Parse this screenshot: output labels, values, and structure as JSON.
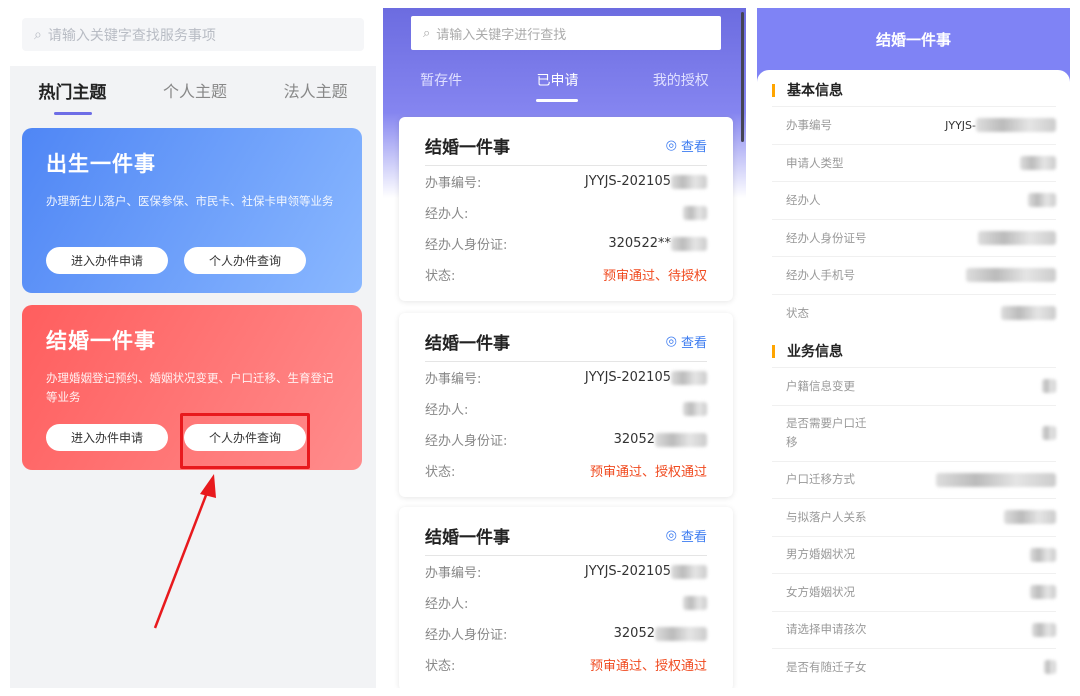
{
  "left": {
    "search_placeholder": "请输入关键字查找服务事项",
    "tabs": [
      "热门主题",
      "个人主题",
      "法人主题"
    ],
    "cards": [
      {
        "title": "出生一件事",
        "desc": "办理新生儿落户、医保参保、市民卡、社保卡申领等业务",
        "btn_apply": "进入办件申请",
        "btn_query": "个人办件查询"
      },
      {
        "title": "结婚一件事",
        "desc": "办理婚姻登记预约、婚姻状况变更、户口迁移、生育登记等业务",
        "btn_apply": "进入办件申请",
        "btn_query": "个人办件查询"
      }
    ]
  },
  "mid": {
    "search_placeholder": "请输入关键字进行查找",
    "tabs": [
      "暂存件",
      "已申请",
      "我的授权"
    ],
    "view_label": "查看",
    "labels": {
      "id": "办事编号:",
      "agent": "经办人:",
      "idcard": "经办人身份证:",
      "status": "状态:"
    },
    "records": [
      {
        "title": "结婚一件事",
        "id": "JYYJS-202105",
        "idcard": "320522**",
        "status": "预审通过、待授权"
      },
      {
        "title": "结婚一件事",
        "id": "JYYJS-202105",
        "idcard": "32052",
        "status": "预审通过、授权通过"
      },
      {
        "title": "结婚一件事",
        "id": "JYYJS-202105",
        "idcard": "32052",
        "status": "预审通过、授权通过"
      }
    ]
  },
  "right": {
    "title": "结婚一件事",
    "basic_title": "基本信息",
    "basic": [
      "办事编号",
      "申请人类型",
      "经办人",
      "经办人身份证号",
      "经办人手机号",
      "状态"
    ],
    "basic_id_value": "JYYJS-",
    "biz_title": "业务信息",
    "biz": [
      "户籍信息变更",
      "是否需要户口迁移",
      "户口迁移方式",
      "与拟落户人关系",
      "男方婚姻状况",
      "女方婚姻状况",
      "请选择申请孩次",
      "是否有随迁子女"
    ]
  }
}
